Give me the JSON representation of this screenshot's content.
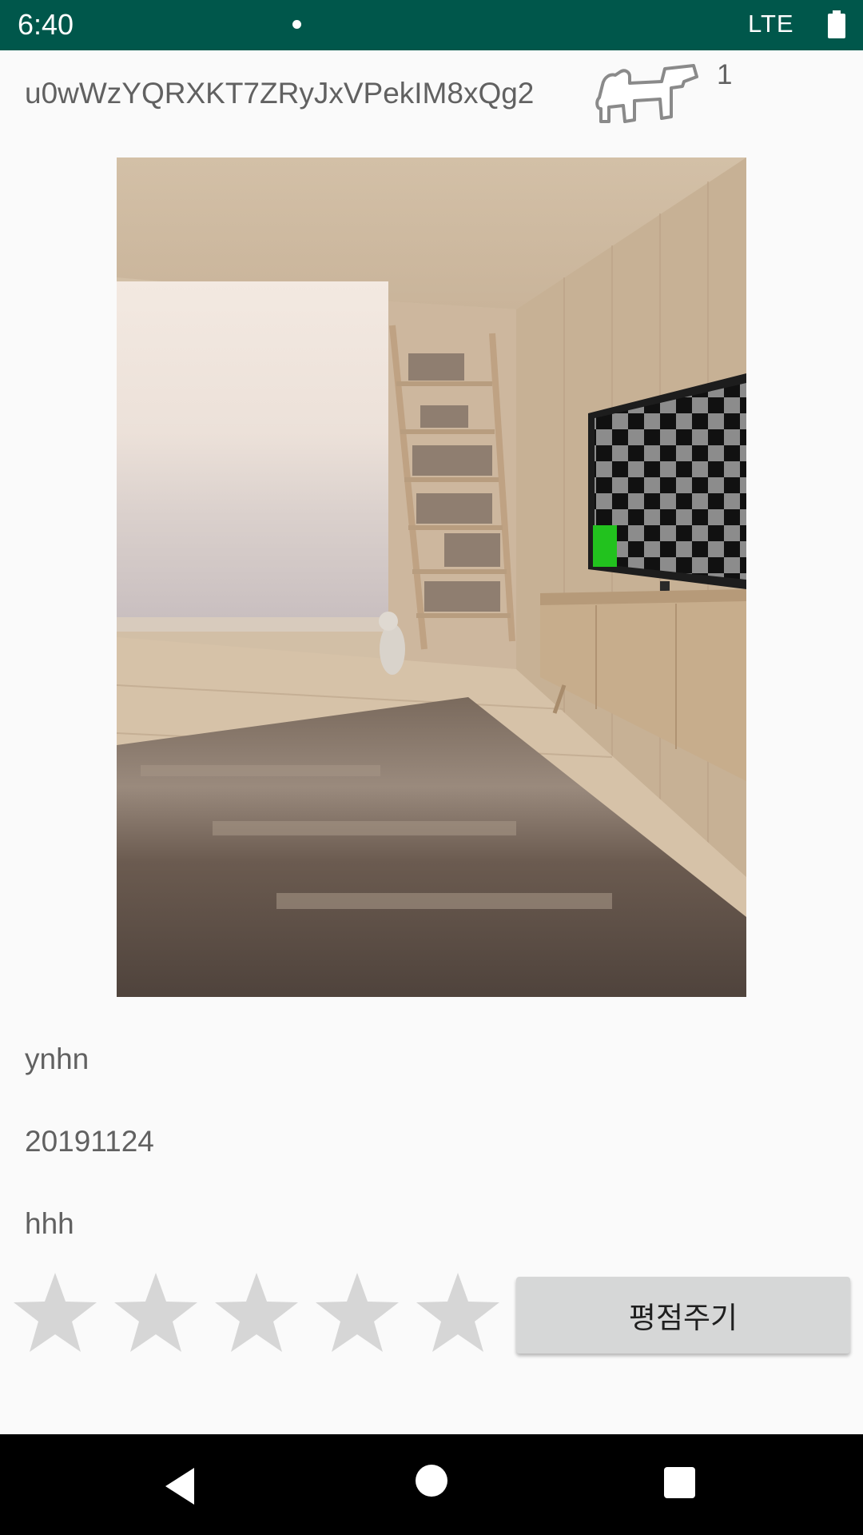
{
  "status_bar": {
    "time": "6:40",
    "network": "LTE",
    "icons": [
      "notification-dot-icon",
      "battery-icon"
    ],
    "background": "#00574b"
  },
  "header": {
    "id": "u0wWzYQRXKT7ZRyJxVPekIM8xQg2",
    "icon": "dog-outline-icon",
    "count": "1"
  },
  "photo": {
    "description_icon": "room-photo"
  },
  "details": {
    "name": "ynhn",
    "date": "20191124",
    "description": "hhh"
  },
  "rating": {
    "stars_total": 5,
    "stars_selected": 0,
    "star_color": "#d6d6d6",
    "button_label": "평점주기"
  },
  "nav_bar": {
    "icons": [
      "back-icon",
      "home-icon",
      "recents-icon"
    ]
  }
}
